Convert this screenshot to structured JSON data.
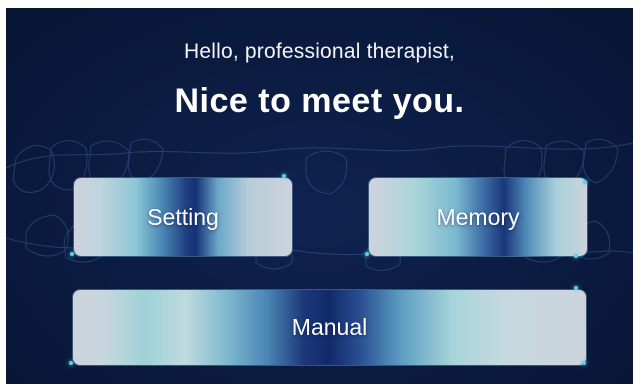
{
  "greeting": {
    "line1": "Hello, professional therapist,",
    "line2": "Nice to meet you."
  },
  "buttons": {
    "setting": "Setting",
    "memory": "Memory",
    "manual": "Manual"
  },
  "colors": {
    "background": "#0b1b40",
    "accent": "#5ad0f0",
    "button_dark": "#173276",
    "button_light": "#cdd3dc"
  }
}
